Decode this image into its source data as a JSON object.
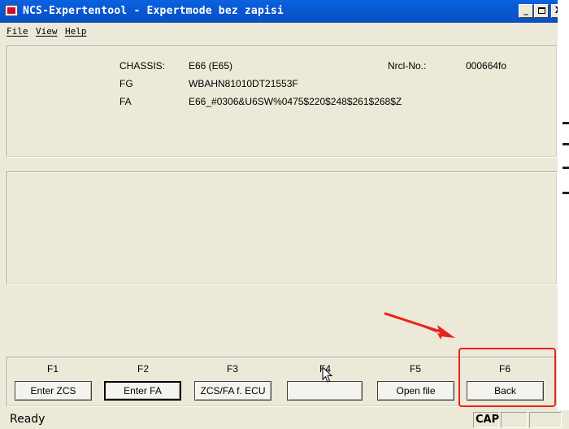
{
  "window": {
    "title": "NCS-Expertentool - Expertmode bez zapisi",
    "controls": {
      "minimize": "_",
      "close": "X"
    }
  },
  "menu": {
    "file": "File",
    "view": "View",
    "help": "Help"
  },
  "vehicle": {
    "chassis_label": "CHASSIS:",
    "chassis_value": "E66 (E65)",
    "nrcl_label": "Nrcl-No.:",
    "nrcl_value": "000664fo",
    "fg_label": "FG",
    "fg_value": "WBAHN81010DT21553F",
    "fa_label": "FA",
    "fa_value": "E66_#0306&U6SW%0475$220$248$261$268$Z"
  },
  "fkeys": [
    {
      "key": "F1",
      "label": "Enter ZCS"
    },
    {
      "key": "F2",
      "label": "Enter FA"
    },
    {
      "key": "F3",
      "label": "ZCS/FA f. ECU"
    },
    {
      "key": "F4",
      "label": ""
    },
    {
      "key": "F5",
      "label": "Open file"
    },
    {
      "key": "F6",
      "label": "Back"
    }
  ],
  "status": {
    "text": "Ready",
    "cap": "CAP"
  },
  "colors": {
    "titlebar": "#0858d3",
    "window_bg": "#ece9d8",
    "annotation": "#e8231c"
  }
}
